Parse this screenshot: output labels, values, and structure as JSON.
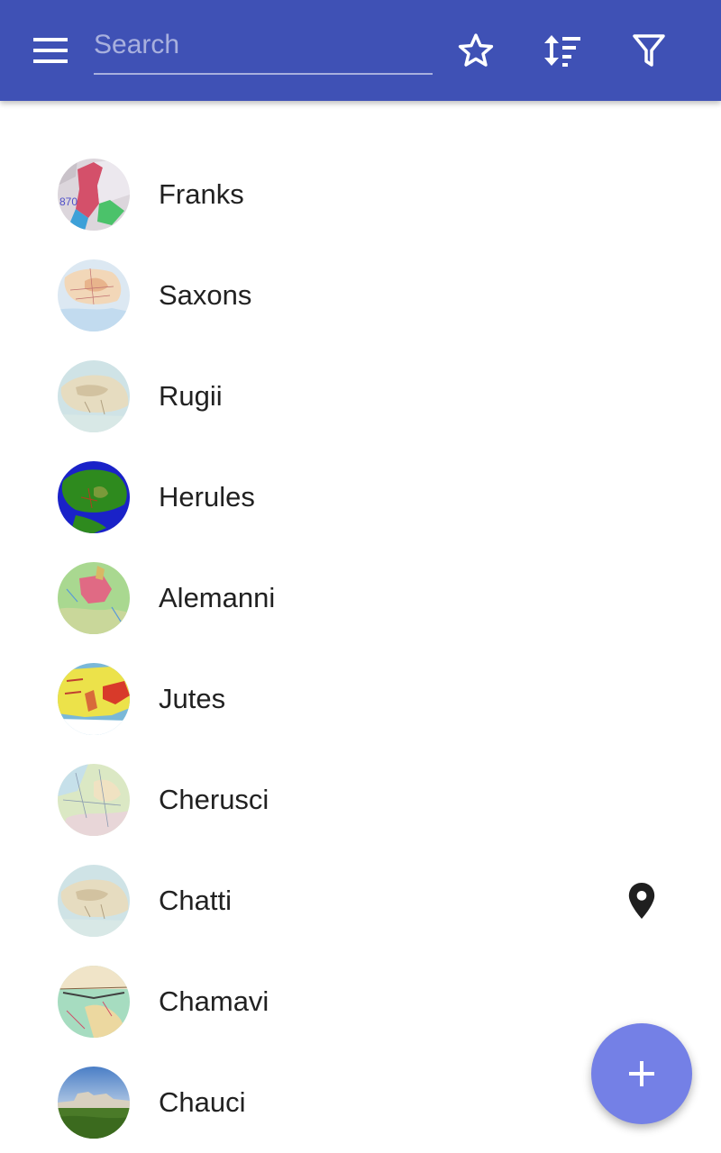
{
  "search": {
    "placeholder": "Search"
  },
  "colors": {
    "appbar": "#3f51b5",
    "fab": "#7480e6",
    "text": "#212121"
  },
  "items": [
    {
      "label": "Franks",
      "icon": "map-thumbnail"
    },
    {
      "label": "Saxons",
      "icon": "map-thumbnail"
    },
    {
      "label": "Rugii",
      "icon": "map-thumbnail"
    },
    {
      "label": "Herules",
      "icon": "map-thumbnail"
    },
    {
      "label": "Alemanni",
      "icon": "map-thumbnail"
    },
    {
      "label": "Jutes",
      "icon": "map-thumbnail"
    },
    {
      "label": "Cherusci",
      "icon": "map-thumbnail"
    },
    {
      "label": "Chatti",
      "icon": "map-thumbnail",
      "location_marker": true
    },
    {
      "label": "Chamavi",
      "icon": "map-thumbnail"
    },
    {
      "label": "Chauci",
      "icon": "landscape-photo"
    }
  ],
  "thumb_texts": {
    "franks_year": "870"
  }
}
